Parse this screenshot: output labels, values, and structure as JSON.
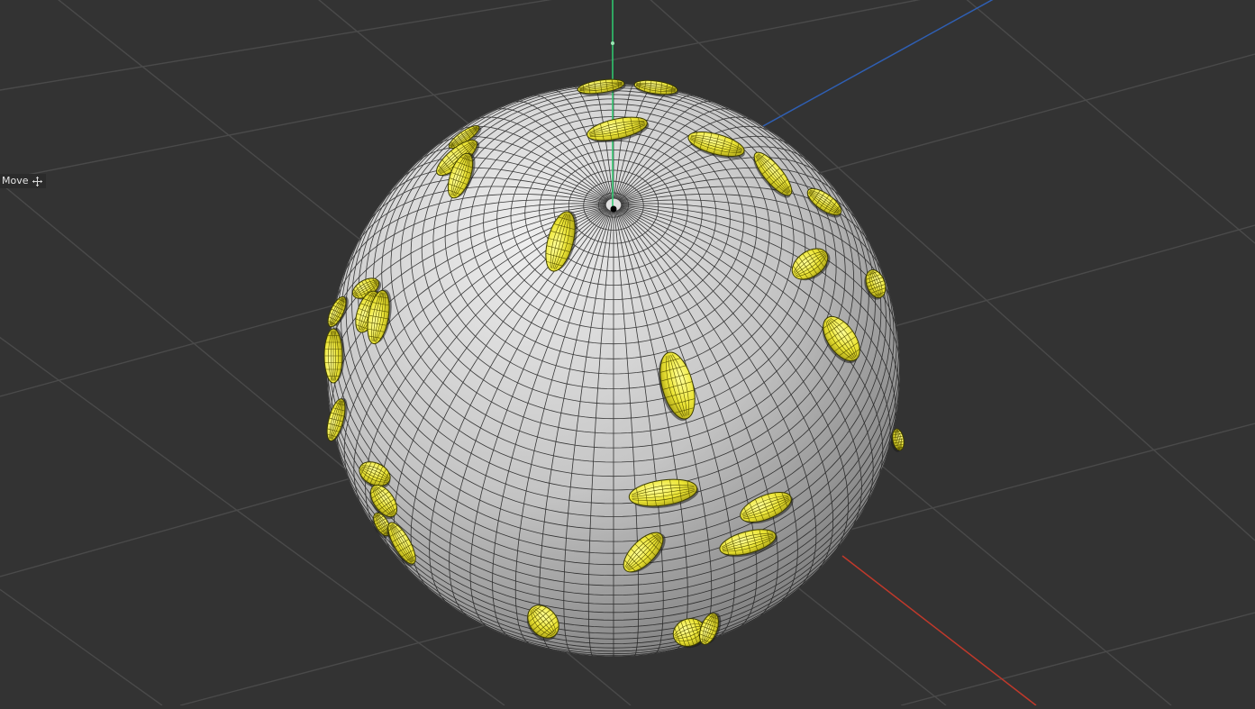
{
  "viewport": {
    "background": "#333333",
    "grid_color": "#4a4a4a",
    "axes": {
      "x_color": "#c0392b",
      "y_color": "#2ecc71",
      "z_color": "#2f5fb3"
    }
  },
  "tool": {
    "label": "Move",
    "icon": "move-icon"
  },
  "scene": {
    "sphere": {
      "fill": "#c9c9c9",
      "wire_color": "#1a1a1a"
    },
    "seed_color": "#f1ee3c",
    "seed_count": 34
  }
}
